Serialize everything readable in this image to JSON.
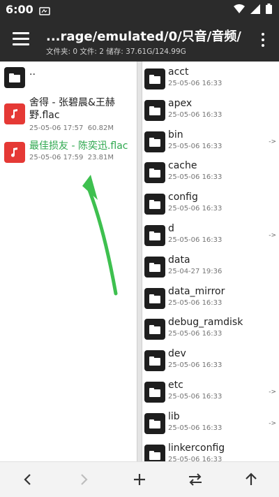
{
  "statusbar": {
    "time": "6:00"
  },
  "appbar": {
    "path": "...rage/emulated/0/只音/音频/",
    "stats": "文件夹: 0  文件: 2  储存: 37.61G/124.99G"
  },
  "left": {
    "parent": {
      "name": ".."
    },
    "files": [
      {
        "name": "舍得 - 张碧晨&王赫野.flac",
        "date": "25-05-06 17:57",
        "size": "60.82M"
      },
      {
        "name": "最佳损友 - 陈奕迅.flac",
        "date": "25-05-06 17:59",
        "size": "23.81M"
      }
    ]
  },
  "right": {
    "folders": [
      {
        "name": "acct",
        "date": "25-05-06 16:33",
        "link": ""
      },
      {
        "name": "apex",
        "date": "25-05-06 16:33",
        "link": ""
      },
      {
        "name": "bin",
        "date": "25-05-06 16:33",
        "link": "->"
      },
      {
        "name": "cache",
        "date": "25-05-06 16:33",
        "link": ""
      },
      {
        "name": "config",
        "date": "25-05-06 16:33",
        "link": ""
      },
      {
        "name": "d",
        "date": "25-05-06 16:33",
        "link": "->"
      },
      {
        "name": "data",
        "date": "25-04-27 19:36",
        "link": ""
      },
      {
        "name": "data_mirror",
        "date": "25-05-06 16:33",
        "link": ""
      },
      {
        "name": "debug_ramdisk",
        "date": "25-05-06 16:33",
        "link": ""
      },
      {
        "name": "dev",
        "date": "25-05-06 16:33",
        "link": ""
      },
      {
        "name": "etc",
        "date": "25-05-06 16:33",
        "link": "->"
      },
      {
        "name": "lib",
        "date": "25-05-06 16:33",
        "link": "->"
      },
      {
        "name": "linkerconfig",
        "date": "25-05-06 16:33",
        "link": ""
      }
    ]
  },
  "bottom": {
    "icons": [
      "back-icon",
      "forward-icon",
      "add-icon",
      "swap-icon",
      "up-icon"
    ]
  },
  "colors": {
    "bar": "#2b2b2b",
    "accent": "#2fa84f",
    "audio": "#e53935"
  }
}
